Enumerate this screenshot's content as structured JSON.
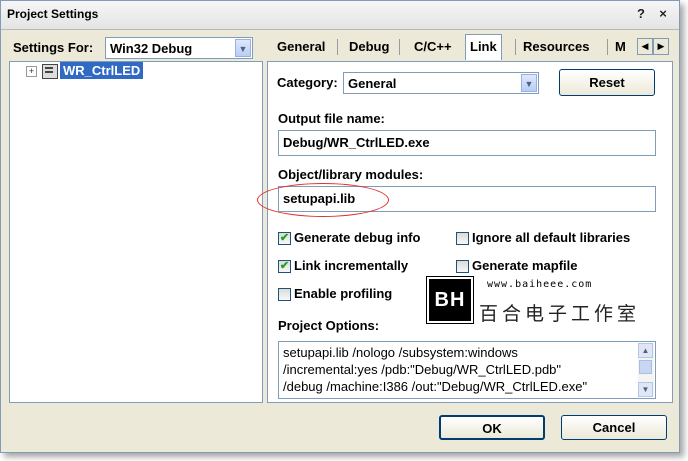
{
  "window": {
    "title": "Project Settings",
    "help": "?",
    "close": "×"
  },
  "settings_for": {
    "label": "Settings For:",
    "value": "Win32 Debug"
  },
  "tree": {
    "expander": "+",
    "item": "WR_CtrlLED"
  },
  "tabs": [
    "General",
    "Debug",
    "C/C++",
    "Link",
    "Resources",
    "M"
  ],
  "active_tab": "Link",
  "category": {
    "label": "Category:",
    "value": "General"
  },
  "reset_button": "Reset",
  "output_file": {
    "label": "Output file name:",
    "value": "Debug/WR_CtrlLED.exe"
  },
  "modules": {
    "label": "Object/library modules:",
    "value": "setupapi.lib"
  },
  "checkboxes": [
    {
      "label": "Generate debug info",
      "checked": true
    },
    {
      "label": "Ignore all default libraries",
      "checked": false
    },
    {
      "label": "Link incrementally",
      "checked": true
    },
    {
      "label": "Generate mapfile",
      "checked": false
    },
    {
      "label": "Enable profiling",
      "checked": false
    }
  ],
  "project_options": {
    "label": "Project Options:",
    "lines": [
      "setupapi.lib /nologo /subsystem:windows",
      "/incremental:yes /pdb:\"Debug/WR_CtrlLED.pdb\"",
      "/debug /machine:I386 /out:\"Debug/WR_CtrlLED.exe\""
    ]
  },
  "watermark": {
    "logo": "BH",
    "url": "www.baiheee.com",
    "name": "百合电子工作室"
  },
  "ok_button": "OK",
  "cancel_button": "Cancel",
  "colors": {
    "annotation": "#e03030",
    "accent": "#003c74"
  }
}
